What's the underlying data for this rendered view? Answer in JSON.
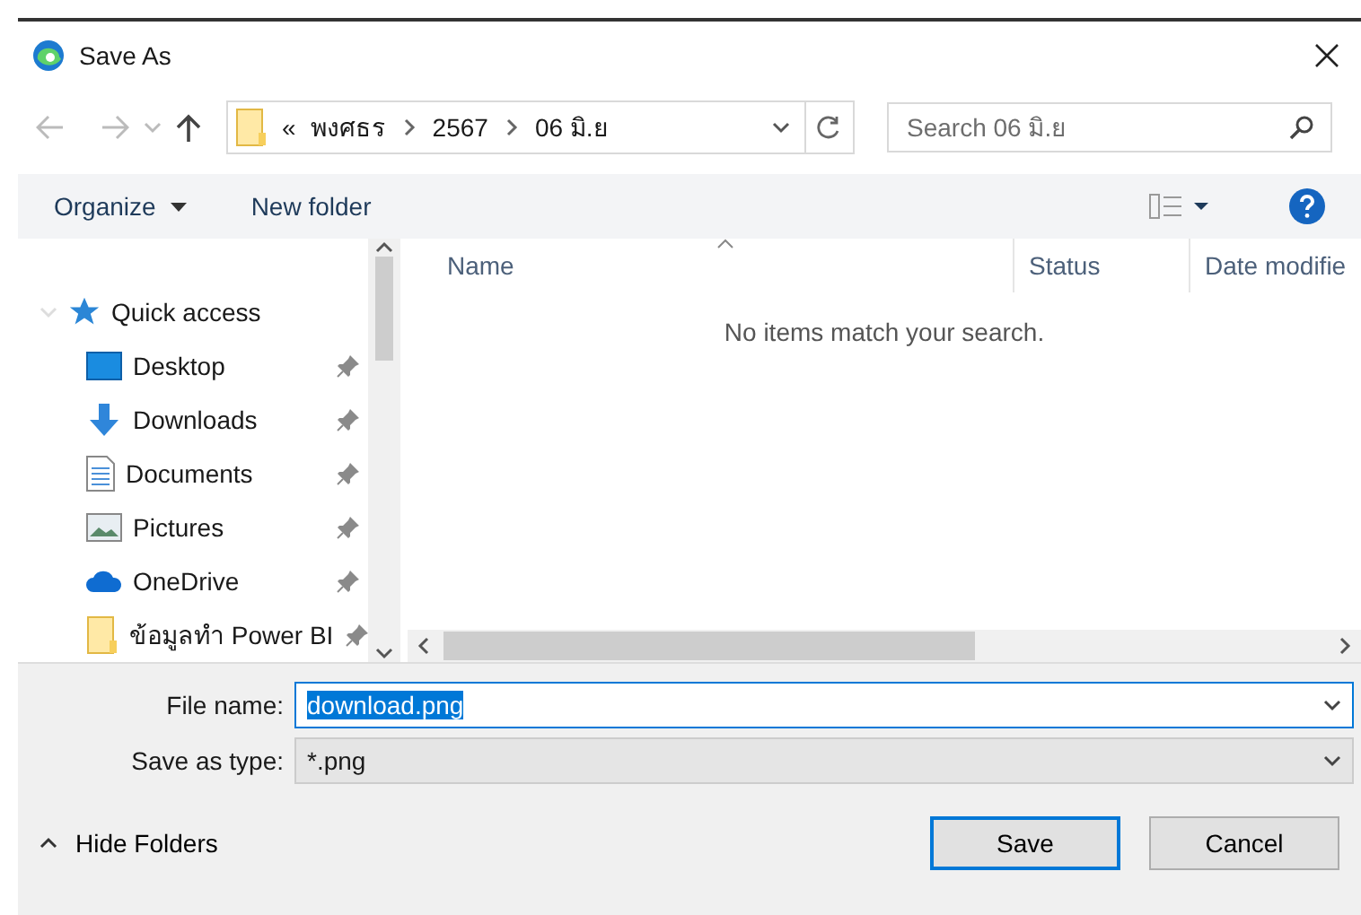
{
  "window": {
    "title": "Save As"
  },
  "address": {
    "overflow": "«",
    "crumbs": [
      "พงศธร",
      "2567",
      "06 มิ.ย"
    ]
  },
  "search": {
    "placeholder": "Search 06 มิ.ย"
  },
  "toolbar": {
    "buttons": [
      {
        "label": "Organize",
        "kind": "menu"
      },
      {
        "label": "New folder",
        "kind": "plain"
      }
    ]
  },
  "sidebar": {
    "items": [
      {
        "label": "Quick access",
        "kind": "star",
        "expanded": true,
        "children": [
          {
            "label": "Desktop",
            "kind": "desktop",
            "pinned": true
          },
          {
            "label": "Downloads",
            "kind": "download",
            "pinned": true
          },
          {
            "label": "Documents",
            "kind": "document",
            "pinned": true
          },
          {
            "label": "Pictures",
            "kind": "pictures",
            "pinned": true
          },
          {
            "label": "OneDrive",
            "kind": "cloud",
            "pinned": true
          },
          {
            "label": "ข้อมูลทำ Power BI",
            "kind": "folder",
            "pinned": true
          }
        ]
      }
    ]
  },
  "file_list": {
    "columns": [
      "Name",
      "Status",
      "Date modifie"
    ],
    "empty_message": "No items match your search."
  },
  "fields": [
    {
      "label": "File name:",
      "value": "download.png",
      "kind": "editable"
    },
    {
      "label": "Save as type:",
      "value": "*.png",
      "kind": "select"
    }
  ],
  "hide_folders": "Hide Folders",
  "buttons": [
    {
      "label": "Save",
      "default": true
    },
    {
      "label": "Cancel",
      "default": false
    }
  ]
}
